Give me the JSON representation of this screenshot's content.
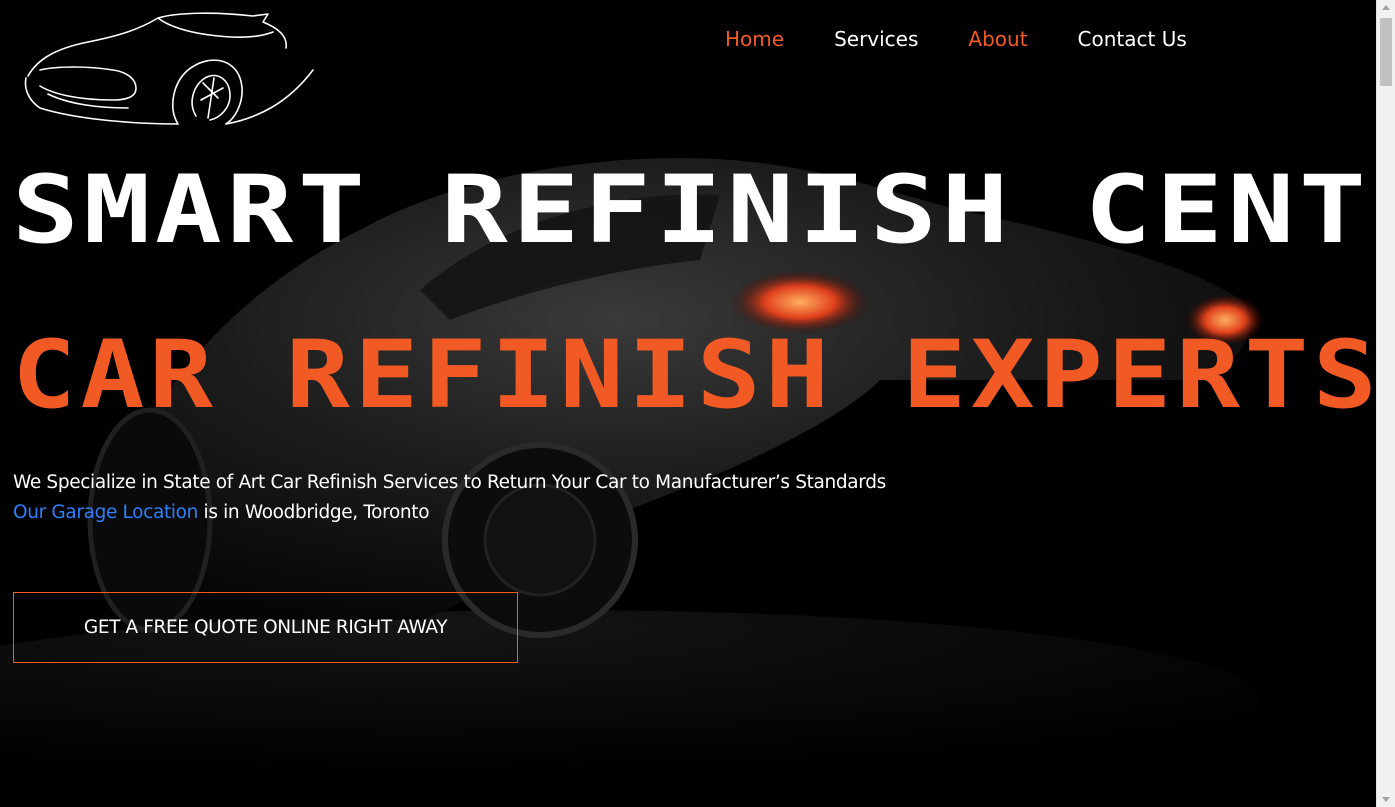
{
  "nav": {
    "items": [
      {
        "label": "Home",
        "state": "active"
      },
      {
        "label": "Services",
        "state": "default"
      },
      {
        "label": "About",
        "state": "hover"
      },
      {
        "label": "Contact Us",
        "state": "default"
      }
    ]
  },
  "hero": {
    "title": "SMART REFINISH CENTER",
    "subtitle": "CAR REFINISH EXPERTS",
    "description": "We Specialize in State of Art Car Refinish Services to Return Your Car to Manufacturer’s Standards",
    "location_link": "Our Garage Location",
    "location_text": " is in Woodbridge, Toronto",
    "cta_label": "GET A FREE QUOTE ONLINE RIGHT AWAY"
  },
  "colors": {
    "accent": "#f15a24",
    "link": "#2d7ff9",
    "background": "#000000",
    "text": "#ffffff"
  },
  "icons": {
    "logo": "car-outline-logo"
  }
}
